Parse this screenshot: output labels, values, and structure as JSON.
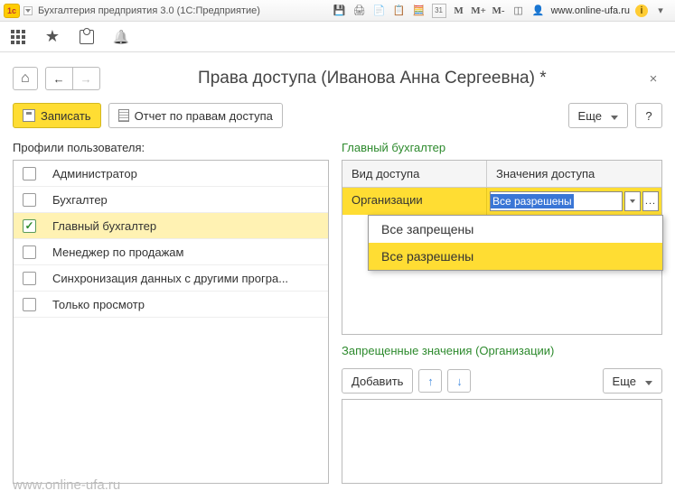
{
  "sysbar": {
    "app_title": "Бухгалтерия предприятия 3.0   (1С:Предприятие)",
    "cal": "31",
    "m_items": [
      "M",
      "M+",
      "M-"
    ],
    "user_link": "www.online-ufa.ru"
  },
  "page": {
    "title": "Права доступа (Иванова Анна Сергеевна) *"
  },
  "actions": {
    "save": "Записать",
    "report": "Отчет по правам доступа",
    "more": "Еще",
    "help": "?"
  },
  "left": {
    "label": "Профили пользователя:",
    "items": [
      {
        "label": "Администратор",
        "checked": false
      },
      {
        "label": "Бухгалтер",
        "checked": false
      },
      {
        "label": "Главный бухгалтер",
        "checked": true
      },
      {
        "label": "Менеджер по продажам",
        "checked": false
      },
      {
        "label": "Синхронизация данных с другими програ...",
        "checked": false
      },
      {
        "label": "Только просмотр",
        "checked": false
      }
    ]
  },
  "right": {
    "section_label": "Главный бухгалтер",
    "col1": "Вид доступа",
    "col2": "Значения доступа",
    "row_kind": "Организации",
    "row_value": "Все разрешены",
    "dropdown": {
      "opt1": "Все запрещены",
      "opt2": "Все разрешены"
    },
    "forbidden_label": "Запрещенные значения (Организации)",
    "add": "Добавить",
    "more": "Еще"
  },
  "watermark": "www.online-ufa.ru"
}
